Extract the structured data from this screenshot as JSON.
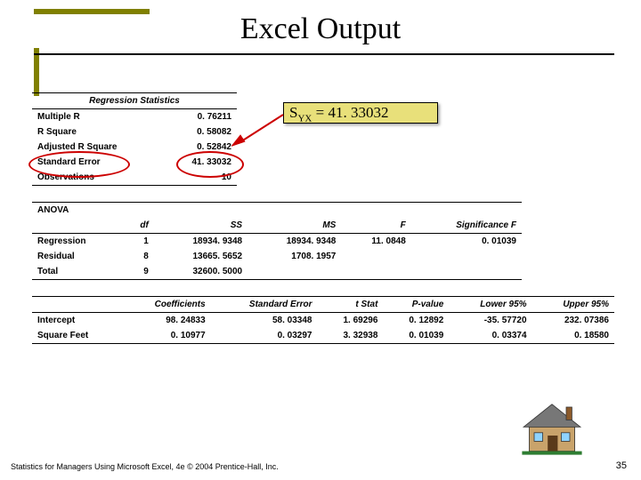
{
  "title": "Excel Output",
  "equation_label_pre": "S",
  "equation_label_sub": "YX",
  "equation_label_post": " = 41. 33032",
  "reg_stats_heading": "Regression Statistics",
  "reg_stats": [
    {
      "label": "Multiple R",
      "value": "0. 76211"
    },
    {
      "label": "R Square",
      "value": "0. 58082"
    },
    {
      "label": "Adjusted R Square",
      "value": "0. 52842"
    },
    {
      "label": "Standard Error",
      "value": "41. 33032"
    },
    {
      "label": "Observations",
      "value": "10"
    }
  ],
  "anova_heading": "ANOVA",
  "anova_cols": {
    "c1": "df",
    "c2": "SS",
    "c3": "MS",
    "c4": "F",
    "c5": "Significance F"
  },
  "anova_rows": [
    {
      "label": "Regression",
      "df": "1",
      "ss": "18934. 9348",
      "ms": "18934. 9348",
      "f": "11. 0848",
      "sig": "0. 01039"
    },
    {
      "label": "Residual",
      "df": "8",
      "ss": "13665. 5652",
      "ms": "1708. 1957",
      "f": "",
      "sig": ""
    },
    {
      "label": "Total",
      "df": "9",
      "ss": "32600. 5000",
      "ms": "",
      "f": "",
      "sig": ""
    }
  ],
  "coef_cols": {
    "c1": "Coefficients",
    "c2": "Standard Error",
    "c3": "t Stat",
    "c4": "P-value",
    "c5": "Lower 95%",
    "c6": "Upper 95%"
  },
  "coef_rows": [
    {
      "label": "Intercept",
      "coef": "98. 24833",
      "se": "58. 03348",
      "t": "1. 69296",
      "p": "0. 12892",
      "lo": "-35. 57720",
      "hi": "232. 07386"
    },
    {
      "label": "Square Feet",
      "coef": "0. 10977",
      "se": "0. 03297",
      "t": "3. 32938",
      "p": "0. 01039",
      "lo": "0. 03374",
      "hi": "0. 18580"
    }
  ],
  "footer": "Statistics for Managers Using Microsoft Excel, 4e © 2004 Prentice-Hall, Inc.",
  "pagenum": "35"
}
